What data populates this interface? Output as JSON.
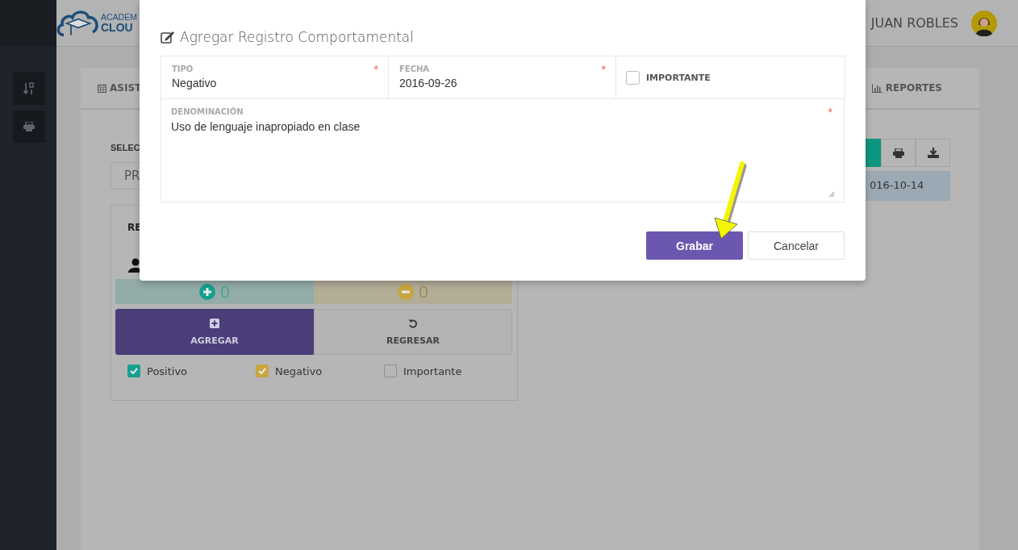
{
  "header": {
    "logo_line_1": "ACADEM",
    "logo_line_2": "CLOU",
    "user_name": "JUAN ROBLES"
  },
  "tabs": [
    {
      "label": "ASIST",
      "selected": false
    },
    {
      "label": "REPORTES",
      "selected": false
    }
  ],
  "section_label": "SELEC",
  "select_value": "PR",
  "date_range": "016-10-14",
  "card": {
    "title": "RE",
    "positive_count": "0",
    "negative_count": "0",
    "add_label": "AGREGAR",
    "back_label": "REGRESAR",
    "filters": [
      {
        "label": "Positivo",
        "checked": true,
        "color": "#14a08f"
      },
      {
        "label": "Negativo",
        "checked": true,
        "color": "#c7a640"
      },
      {
        "label": "Importante",
        "checked": false
      }
    ]
  },
  "modal": {
    "title": "Agregar Registro Comportamental",
    "fields": [
      {
        "kind": "text",
        "label": "TIPO",
        "value": "Negativo",
        "required_mark": "*"
      },
      {
        "kind": "text",
        "label": "FECHA",
        "value": "2016-09-26",
        "required_mark": "*"
      },
      {
        "kind": "checkbox",
        "label": "IMPORTANTE",
        "checked": false
      }
    ],
    "textarea": {
      "label": "DENOMINACIÓN",
      "value": "Uso de lenguaje inapropiado en clase",
      "required_mark": "*"
    },
    "buttons": [
      {
        "kind": "primary",
        "label": "Grabar"
      },
      {
        "kind": "default",
        "label": "Cancelar"
      }
    ]
  }
}
